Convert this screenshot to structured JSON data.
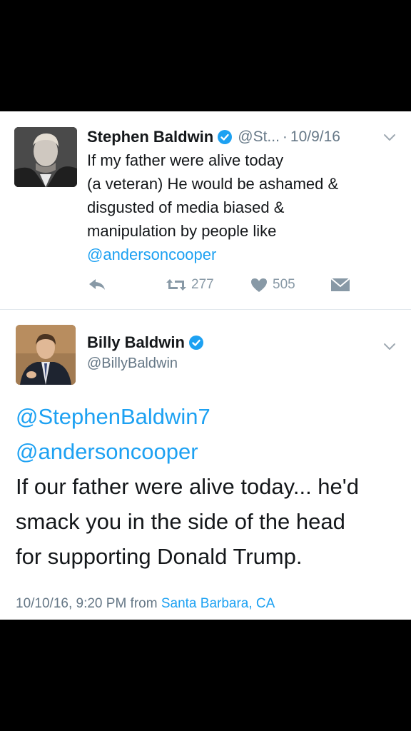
{
  "tweet1": {
    "display_name": "Stephen Baldwin",
    "handle_truncated": "@St...",
    "separator": "·",
    "date": "10/9/16",
    "body_lines": [
      "If my father were alive today",
      "(a veteran) He would be ashamed &",
      "disgusted of media biased &",
      "manipulation by people like"
    ],
    "mention": "@andersoncooper",
    "retweet_count": "277",
    "like_count": "505",
    "icons": [
      "verified-icon",
      "chevron-down-icon",
      "reply-icon",
      "retweet-icon",
      "like-icon",
      "direct-message-icon"
    ]
  },
  "tweet2": {
    "display_name": "Billy Baldwin",
    "handle": "@BillyBaldwin",
    "mention_1": "@StephenBaldwin7",
    "mention_2": "@andersoncooper",
    "body_lines": [
      "If our father were alive today... he'd",
      "smack you in the side of the head",
      "for supporting Donald Trump."
    ],
    "timestamp": "10/10/16, 9:20 PM from",
    "location": "Santa Barbara, CA",
    "icons": [
      "verified-icon",
      "chevron-down-icon"
    ]
  },
  "colors": {
    "link": "#1da1f2",
    "verified": "#1da1f2",
    "secondary_text": "#657786",
    "action_icons": "#8899a6"
  }
}
